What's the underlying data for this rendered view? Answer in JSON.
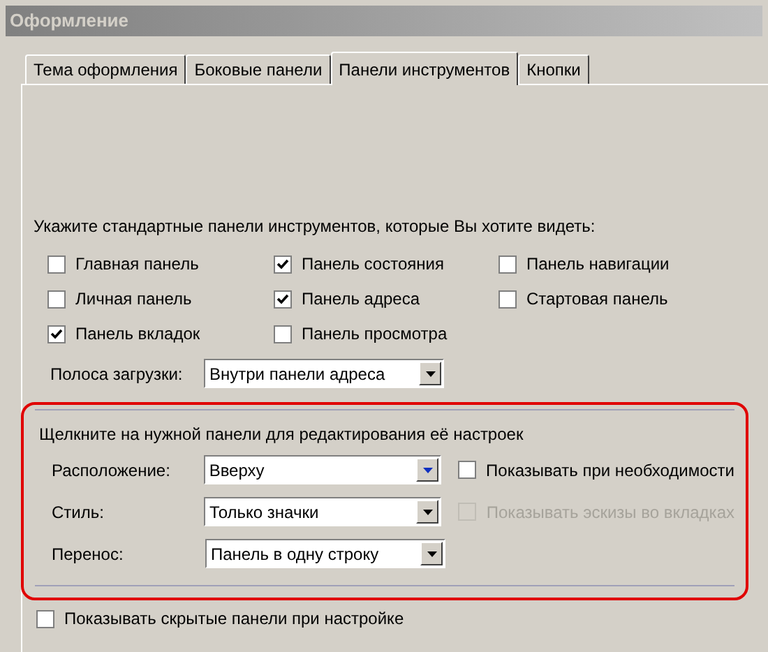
{
  "window": {
    "title": "Оформление"
  },
  "tabs": [
    {
      "label": "Тема оформления",
      "selected": false
    },
    {
      "label": "Боковые панели",
      "selected": false
    },
    {
      "label": "Панели инструментов",
      "selected": true
    },
    {
      "label": "Кнопки",
      "selected": false
    }
  ],
  "toolbars": {
    "prompt": "Укажите стандартные панели инструментов, которые Вы хотите видеть:",
    "columns": [
      [
        {
          "label": "Главная панель",
          "checked": false
        },
        {
          "label": "Личная панель",
          "checked": false
        },
        {
          "label": "Панель вкладок",
          "checked": true
        }
      ],
      [
        {
          "label": "Панель состояния",
          "checked": true
        },
        {
          "label": "Панель адреса",
          "checked": true
        },
        {
          "label": "Панель просмотра",
          "checked": false
        }
      ],
      [
        {
          "label": "Панель навигации",
          "checked": false
        },
        {
          "label": "Стартовая панель",
          "checked": false
        }
      ]
    ],
    "loading_bar": {
      "label": "Полоса загрузки:",
      "value": "Внутри панели адреса",
      "focused": false
    }
  },
  "panel_settings": {
    "prompt": "Щелкните на нужной панели для редактирования её настроек",
    "rows": [
      {
        "label": "Расположение:",
        "value": "Вверху",
        "focused": true,
        "option": {
          "label": "Показывать при необходимости",
          "checked": false,
          "disabled": false
        }
      },
      {
        "label": "Стиль:",
        "value": "Только значки",
        "focused": false,
        "option": {
          "label": "Показывать эскизы во вкладках",
          "checked": false,
          "disabled": true
        }
      },
      {
        "label": "Перенос:",
        "value": "Панель в одну строку",
        "focused": false
      }
    ]
  },
  "show_hidden": {
    "label": "Показывать скрытые панели при настройке",
    "checked": false
  }
}
